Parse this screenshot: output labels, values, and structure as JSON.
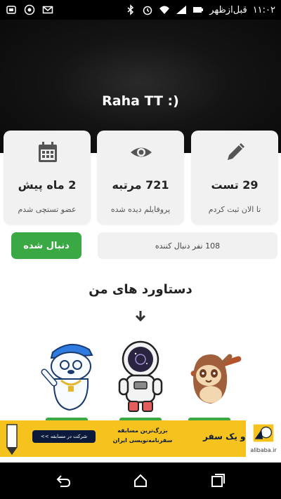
{
  "status_bar": {
    "time": "۱۱:۰۲",
    "period": "قبل‌ازظهر",
    "icons": [
      "bluetooth-icon",
      "alarm-icon",
      "wifi-icon",
      "signal-icon",
      "battery-icon",
      "notification-icon",
      "chrome-icon",
      "gmail-icon"
    ]
  },
  "profile": {
    "name": "Raha TT :)"
  },
  "stats": [
    {
      "icon": "pencil-icon",
      "value": "29 تست",
      "label": "تا الان ثبت کردم"
    },
    {
      "icon": "eye-icon",
      "value": "721 مرتبه",
      "label": "پروفایلم دیده شده"
    },
    {
      "icon": "calendar-icon",
      "value": "2 ماه پیش",
      "label": "عضو تستچی شدم"
    }
  ],
  "follow": {
    "button_label": "دنبال شده",
    "followers_text": "108 نفر دنبال کننده"
  },
  "achievements": {
    "title": "دستاورد های من",
    "badges": [
      "sloth-badge",
      "astronaut-badge",
      "polar-bear-badge"
    ]
  },
  "ad": {
    "brand": "هزار و یک سفر",
    "line1": "بزرگ‌ترین مسابقه",
    "line2": "سفرنامه‌نویسی ایران",
    "cta": "شرکت در مسابقه >>",
    "logo_text": "alibaba.ir",
    "colors": {
      "background": "#f6c21d",
      "navy": "#0b1a3a"
    }
  },
  "nav": {
    "buttons": [
      "back-icon",
      "home-icon",
      "recents-icon"
    ]
  },
  "colors": {
    "accent": "#3aa843",
    "card": "#f1f1f1",
    "header": "#111111"
  }
}
